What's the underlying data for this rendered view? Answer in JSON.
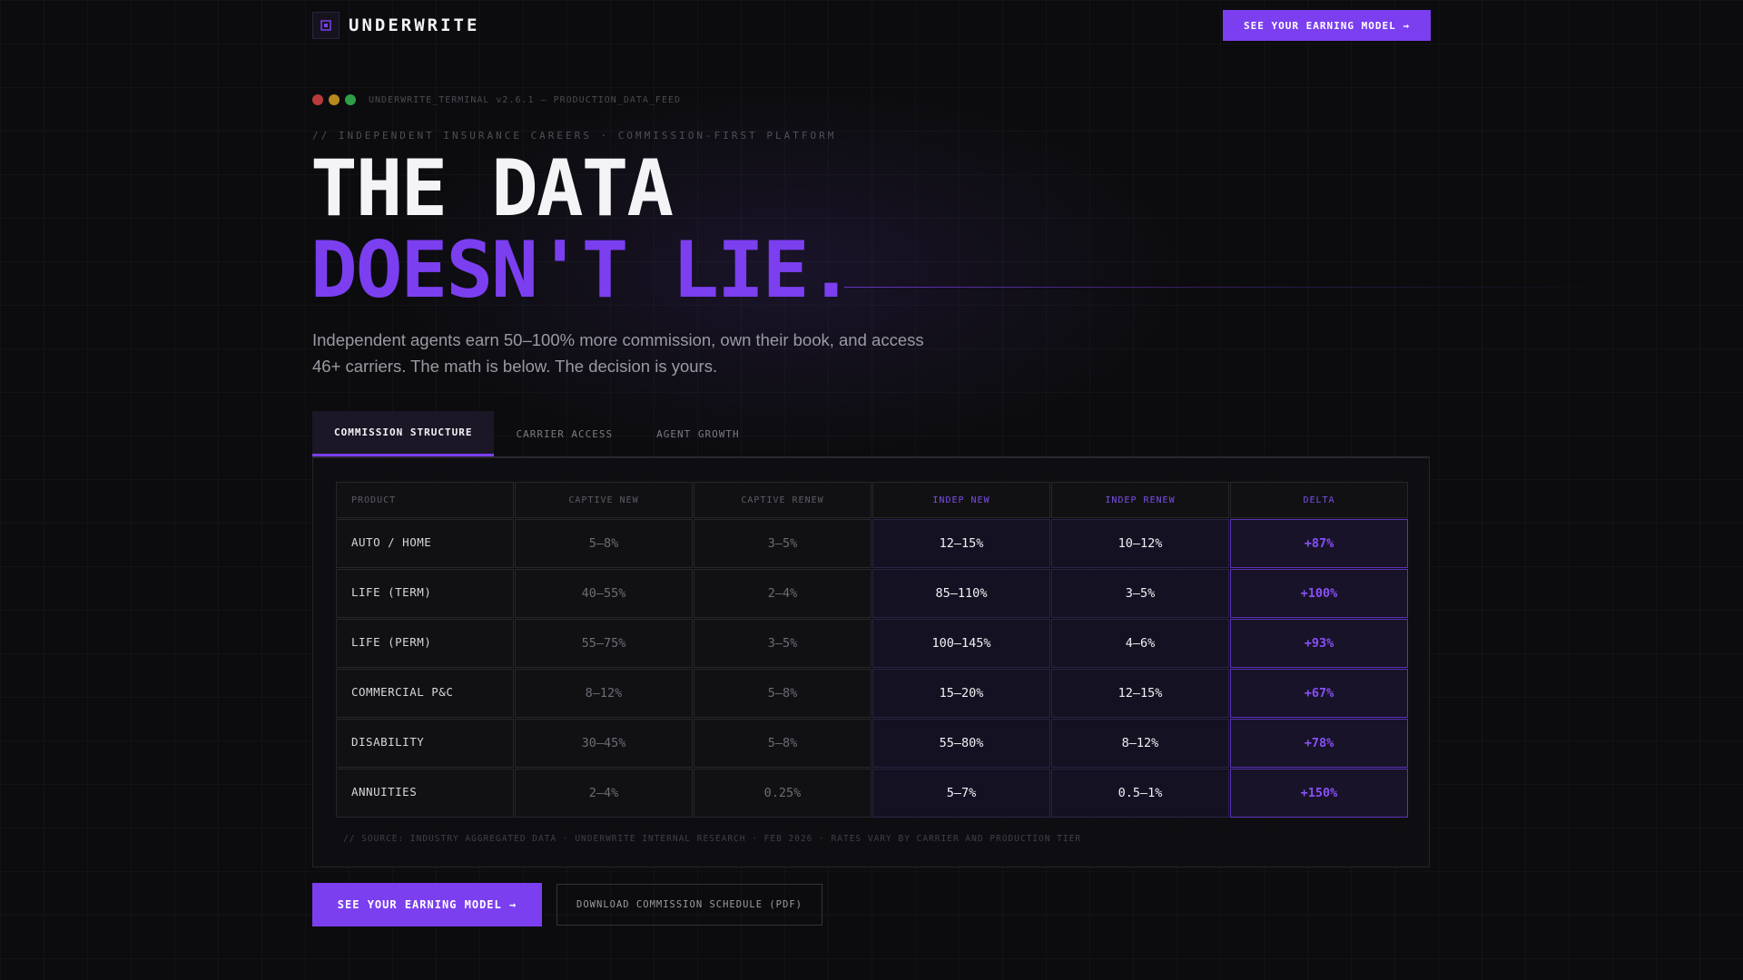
{
  "header": {
    "logo_text": "UNDERWRITE",
    "logo_icon": "logo-icon",
    "cta_label": "SEE YOUR EARNING MODEL →"
  },
  "terminal": {
    "text": "UNDERWRITE_TERMINAL v2.6.1 — PRODUCTION_DATA_FEED",
    "dot_colors": [
      "#b83a3a",
      "#b8891e",
      "#2e9e45"
    ]
  },
  "hero": {
    "eyebrow": "// INDEPENDENT INSURANCE CAREERS · COMMISSION-FIRST PLATFORM",
    "title_line1": "THE DATA",
    "title_line2": "DOESN'T LIE.",
    "subtitle": "Independent agents earn 50–100% more commission, own their book, and access 46+ carriers. The math is below. The decision is yours."
  },
  "tabs": [
    {
      "label": "COMMISSION STRUCTURE",
      "active": true
    },
    {
      "label": "CARRIER ACCESS",
      "active": false
    },
    {
      "label": "AGENT GROWTH",
      "active": false
    }
  ],
  "table": {
    "headers": [
      "PRODUCT",
      "CAPTIVE NEW",
      "CAPTIVE RENEW",
      "INDEP NEW",
      "INDEP RENEW",
      "DELTA"
    ],
    "rows": [
      {
        "product": "AUTO / HOME",
        "captive_new": "5–8%",
        "captive_renew": "3–5%",
        "indep_new": "12–15%",
        "indep_renew": "10–12%",
        "delta": "+87%"
      },
      {
        "product": "LIFE (TERM)",
        "captive_new": "40–55%",
        "captive_renew": "2–4%",
        "indep_new": "85–110%",
        "indep_renew": "3–5%",
        "delta": "+100%"
      },
      {
        "product": "LIFE (PERM)",
        "captive_new": "55–75%",
        "captive_renew": "3–5%",
        "indep_new": "100–145%",
        "indep_renew": "4–6%",
        "delta": "+93%"
      },
      {
        "product": "COMMERCIAL P&C",
        "captive_new": "8–12%",
        "captive_renew": "5–8%",
        "indep_new": "15–20%",
        "indep_renew": "12–15%",
        "delta": "+67%"
      },
      {
        "product": "DISABILITY",
        "captive_new": "30–45%",
        "captive_renew": "5–8%",
        "indep_new": "55–80%",
        "indep_renew": "8–12%",
        "delta": "+78%"
      },
      {
        "product": "ANNUITIES",
        "captive_new": "2–4%",
        "captive_renew": "0.25%",
        "indep_new": "5–7%",
        "indep_renew": "0.5–1%",
        "delta": "+150%"
      }
    ],
    "source": "// SOURCE: INDUSTRY AGGREGATED DATA · UNDERWRITE INTERNAL RESEARCH · FEB 2026 · RATES VARY BY CARRIER AND PRODUCTION TIER"
  },
  "actions": {
    "primary_label": "SEE YOUR EARNING MODEL →",
    "secondary_label": "DOWNLOAD COMMISSION SCHEDULE (PDF)"
  },
  "colors": {
    "accent": "#7b3ff0",
    "background": "#0c0c0e"
  }
}
